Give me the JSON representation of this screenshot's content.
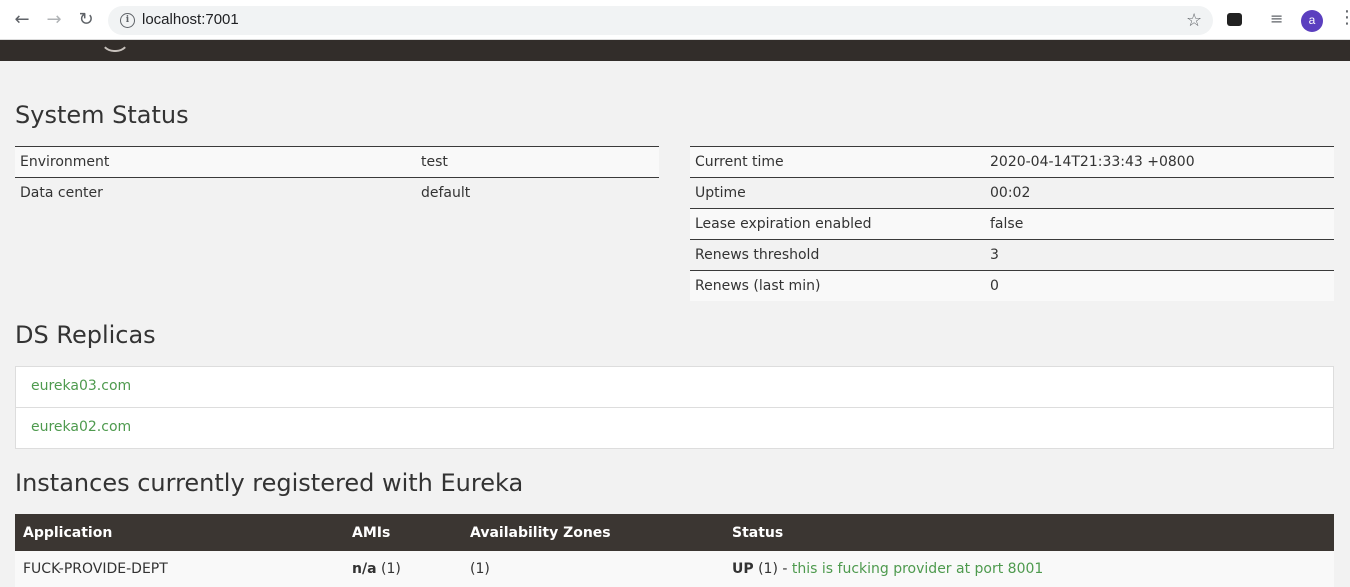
{
  "browser": {
    "url": "localhost:7001",
    "profile_initial": "a",
    "accent": "#5b3fbf"
  },
  "system_status": {
    "title": "System Status",
    "left": [
      {
        "key": "Environment",
        "value": "test"
      },
      {
        "key": "Data center",
        "value": "default"
      }
    ],
    "right": [
      {
        "key": "Current time",
        "value": "2020-04-14T21:33:43 +0800"
      },
      {
        "key": "Uptime",
        "value": "00:02"
      },
      {
        "key": "Lease expiration enabled",
        "value": "false"
      },
      {
        "key": "Renews threshold",
        "value": "3"
      },
      {
        "key": "Renews (last min)",
        "value": "0"
      }
    ]
  },
  "replicas": {
    "title": "DS Replicas",
    "items": [
      "eureka03.com",
      "eureka02.com"
    ]
  },
  "instances": {
    "title": "Instances currently registered with Eureka",
    "headers": [
      "Application",
      "AMIs",
      "Availability Zones",
      "Status"
    ],
    "rows": [
      {
        "application": "FUCK-PROVIDE-DEPT",
        "ami": "n/a",
        "ami_count": "(1)",
        "zones": "(1)",
        "status": "UP",
        "status_count": "(1) -",
        "status_link": "this is fucking provider at port 8001"
      }
    ]
  },
  "colors": {
    "nav_dark": "#322d2a",
    "link_green": "#4e9a4e",
    "header_dark": "#3b3632"
  }
}
